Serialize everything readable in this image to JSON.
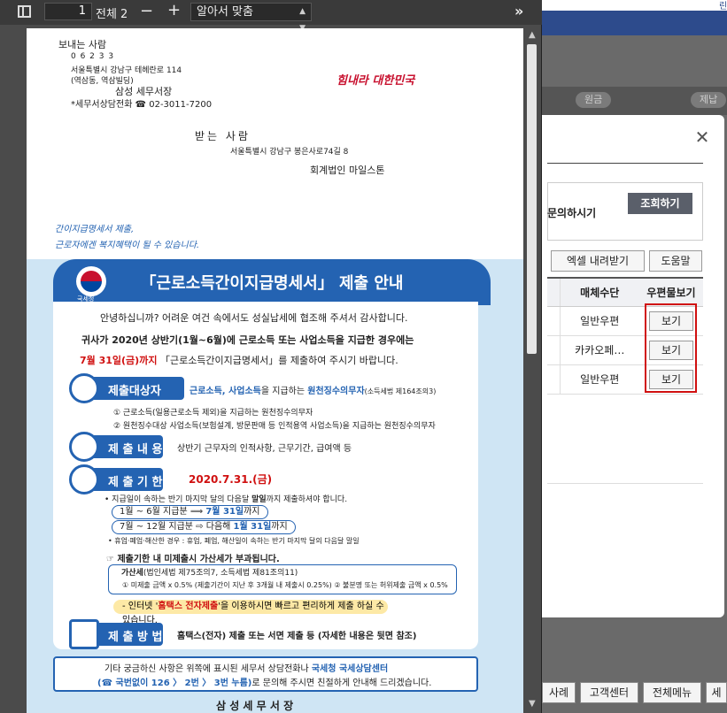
{
  "viewer": {
    "toolbar": {
      "page_number": "1",
      "page_total": "전체 2",
      "zoom_label": "알아서 맞춤",
      "minus": "−",
      "plus": "+"
    }
  },
  "document": {
    "sender": {
      "heading": "보내는 사람",
      "postal_code": "0 6 2 3 3",
      "address_1": "서울특별시 강남구 테헤란로 114",
      "address_2": "(역삼동, 역삼빌딩)",
      "office": "삼성 세무서장",
      "phone": "*세무서상담전화 ☎ 02-3011-7200"
    },
    "slogan": "힘내라 대한민국",
    "receiver": {
      "heading": "받는 사람",
      "address": "서울특별시 강남구 봉은사로74길 8",
      "name": "회계법인 마일스톤"
    },
    "handwriting_1": "간이지급명세서 제출,",
    "handwriting_2": "근로자에겐 복지혜택이 될 수 있습니다.",
    "poster": {
      "agency": "국세청",
      "title": "「근로소득간이지급명세서」 제출 안내",
      "greeting": "안녕하십니까? 어려운 여건 속에서도 성실납세에 협조해 주셔서 감사합니다.",
      "lead_1": "귀사가 2020년 상반기(1월~6월)에 근로소득 또는 사업소득을 지급한 경우에는",
      "lead_2_red": "7월 31일(금)까지",
      "lead_2_rest": " 「근로소득간이지급명세서」를 제출하여 주시기 바랍니다.",
      "sec1_label": "제출대상자",
      "sec1_text_blue": "근로소득, 사업소득",
      "sec1_text_mid": "을 지급하는 ",
      "sec1_text_blue2": "원천징수의무자",
      "sec1_text_small": "(소득세법 제164조의3)",
      "sec1_item_1": "① 근로소득(일용근로소득 제외)을 지급하는 원천징수의무자",
      "sec1_item_2": "② 원천징수대상 사업소득(보험설계, 방문판매 등 인적용역 사업소득)을 지급하는 원천징수의무자",
      "sec2_label": "제 출 내 용",
      "sec2_text": "상반기 근무자의 인적사항, 근무기간, 급여액 등",
      "sec3_label": "제 출 기 한",
      "sec3_date": "2020.7.31.(금)",
      "sec3_note_a": "• 지급일이 속하는 반기 마지막 달의 다음달 ",
      "sec3_note_bold": "말일",
      "sec3_note_b": "까지 제출하셔야 합니다.",
      "pill_1a": "1월 ~ 6월 지급분 ⟹ ",
      "pill_1b": "7월 31일",
      "pill_1c": "까지",
      "pill_2a": "7월 ~ 12월 지급분 ⇨ 다음해 ",
      "pill_2b": "1월 31일",
      "pill_2c": "까지",
      "closure_note": "• 휴업·폐업·해산한 경우 : 휴업, 폐업, 해산일이 속하는 반기 마지막 달의 다음달 말일",
      "penalty_head": "☞ 제출기한 내 미제출시 가산세가 부과됩니다.",
      "penalty_title_b": "가산세",
      "penalty_title_rest": "(법인세법 제75조의7, 소득세법 제81조의11)",
      "penalty_detail": "① 미제출 금액 x 0.5% (제출기간이 지난 후 3개월 내 제출시 0.25%)   ② 불분명 또는 허위제출 금액 x 0.5%",
      "hometax_note_a": "- 인터넷 '",
      "hometax_note_red": "홈택스 전자제출",
      "hometax_note_b": "'을 이용하시면 빠르고 편리하게 제출 하실 수 있습니다.",
      "sec4_label": "제 출 방 법",
      "sec4_text": "홈택스(전자) 제출 또는 서면 제출 등 (자세한 내용은 뒷면 참조)",
      "footer_1a": "기타 궁금하신 사항은 위쪽에 표시된 세무서 상담전화나 ",
      "footer_1b": "국세청 국세상담센터",
      "footer_2a": "(☎ 국번없이 126 〉 2번 〉 3번 누름)",
      "footer_2b": "로 문의해 주시면 친절하게 안내해 드리겠습니다.",
      "bottom_cut": "삼 성   세 무 서 장"
    }
  },
  "background_app": {
    "tab_1": "원금",
    "tab_2": "제납",
    "info_text": "문의하시기",
    "inquire_button": "조회하기",
    "excel_button": "엑셀 내려받기",
    "help_button": "도움말",
    "columns": [
      "매체수단",
      "우편물보기"
    ],
    "rows": [
      {
        "medium": "일반우편",
        "view": "보기"
      },
      {
        "medium": "카카오페…",
        "view": "보기"
      },
      {
        "medium": "일반우편",
        "view": "보기"
      }
    ],
    "footer_buttons": [
      "사례",
      "고객센터",
      "전체메뉴",
      "세무"
    ],
    "top_link": "린"
  },
  "colors": {
    "accent_blue": "#2463b2",
    "highlight_red": "#d01010",
    "navy": "#2d4b8c"
  }
}
